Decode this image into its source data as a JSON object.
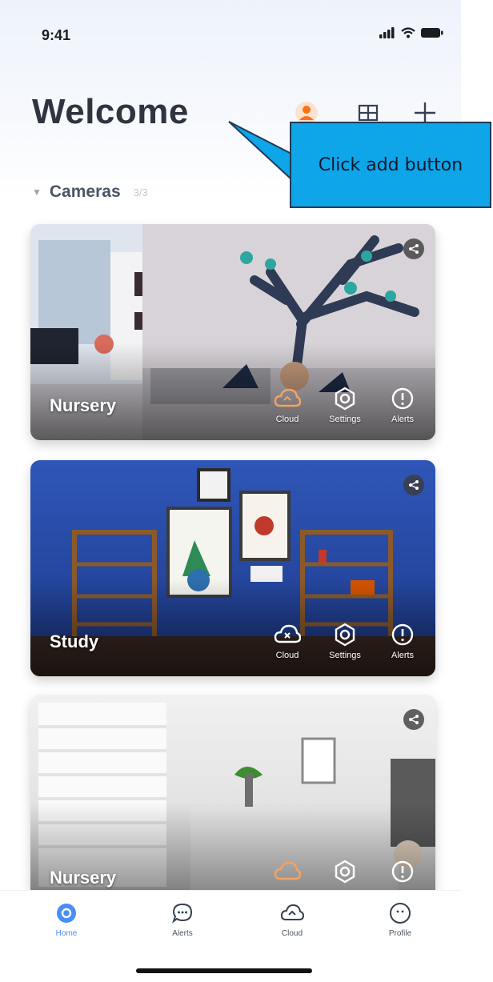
{
  "status_bar": {
    "time": "9:41"
  },
  "header": {
    "title": "Welcome",
    "icons": [
      "person-icon",
      "grid-view-icon",
      "add-icon"
    ]
  },
  "section": {
    "title": "Cameras",
    "count": "3/3"
  },
  "cameras": [
    {
      "name": "Nursery",
      "actions": [
        "Cloud",
        "Settings",
        "Alerts"
      ]
    },
    {
      "name": "Study",
      "actions": [
        "Cloud",
        "Settings",
        "Alerts"
      ]
    },
    {
      "name": "Nursery",
      "actions": [
        "Cloud",
        "Settings",
        "Alerts"
      ]
    }
  ],
  "tabbar": {
    "tabs": [
      {
        "label": "Home",
        "icon": "home-icon",
        "active": true
      },
      {
        "label": "Alerts",
        "icon": "chat-icon",
        "active": false
      },
      {
        "label": "Cloud",
        "icon": "cloud-icon",
        "active": false
      },
      {
        "label": "Profile",
        "icon": "profile-icon",
        "active": false
      }
    ]
  },
  "callout": {
    "text": "Click add button"
  },
  "colors": {
    "accent": "#4a8df5",
    "callout": "#0ea5e9"
  }
}
